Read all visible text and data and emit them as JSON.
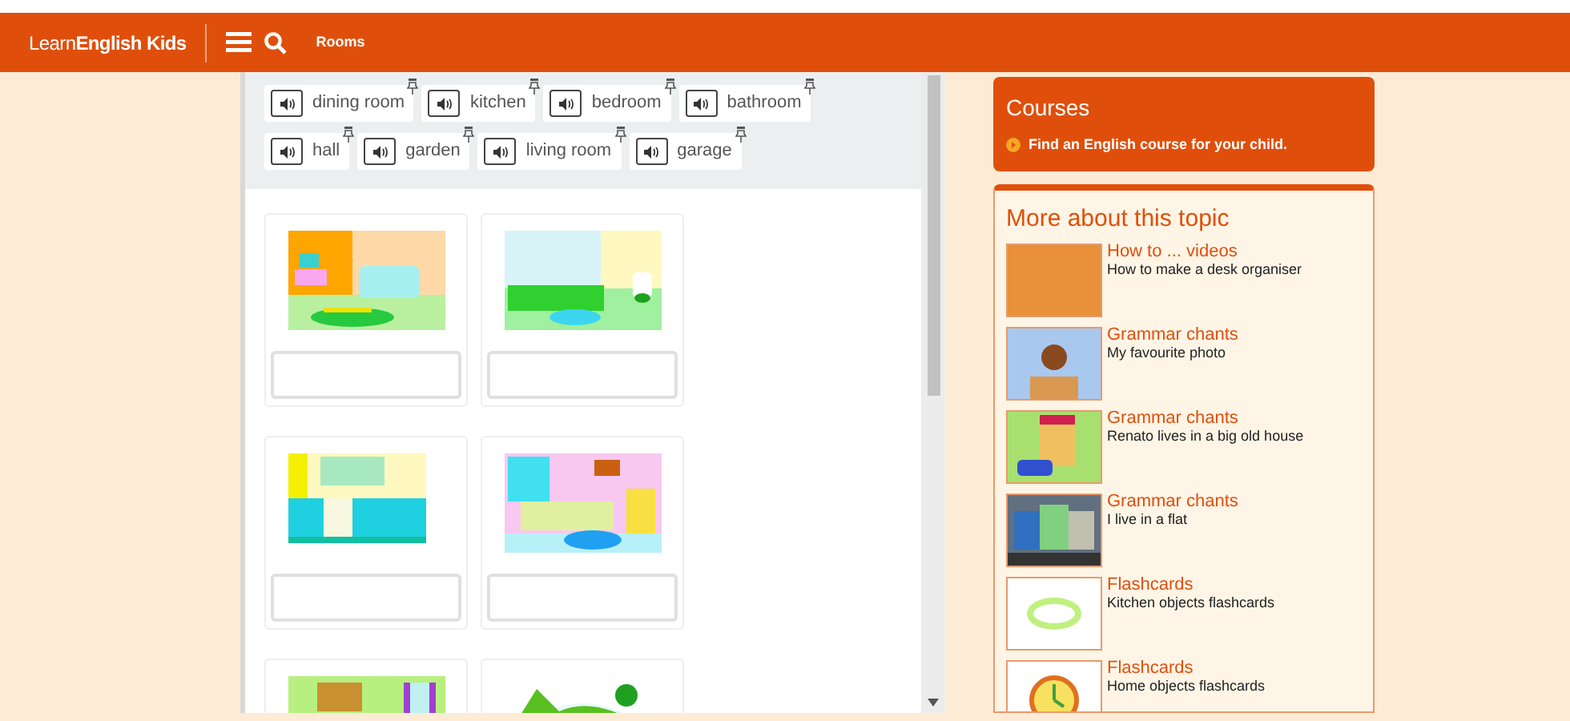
{
  "header": {
    "logo": "Learn**English Kids**",
    "breadcrumb": "Rooms"
  },
  "word_bank": [
    {
      "word": "dining room"
    },
    {
      "word": "kitchen"
    },
    {
      "word": "bedroom"
    },
    {
      "word": "bathroom"
    },
    {
      "word": "hall"
    },
    {
      "word": "garden"
    },
    {
      "word": "living room"
    },
    {
      "word": "garage"
    }
  ],
  "cards": [
    {
      "kind": "living_room"
    },
    {
      "kind": "bathroom"
    },
    {
      "kind": "kitchen"
    },
    {
      "kind": "bedroom"
    },
    {
      "kind": "hall"
    },
    {
      "kind": "garden"
    }
  ],
  "courses": {
    "title": "Courses",
    "link": "Find an English course for your child."
  },
  "more_about": {
    "title": "More about this topic",
    "items": [
      {
        "kind": "photo",
        "category": "How to ... videos",
        "title": "How to make a desk organiser"
      },
      {
        "kind": "cartoon",
        "category": "Grammar chants",
        "title": "My favourite photo"
      },
      {
        "kind": "house",
        "category": "Grammar chants",
        "title": "Renato lives in a big old house"
      },
      {
        "kind": "street",
        "category": "Grammar chants",
        "title": "I live in a flat"
      },
      {
        "kind": "ring",
        "category": "Flashcards",
        "title": "Kitchen objects flashcards"
      },
      {
        "kind": "clock",
        "category": "Flashcards",
        "title": "Home objects flashcards"
      }
    ]
  }
}
